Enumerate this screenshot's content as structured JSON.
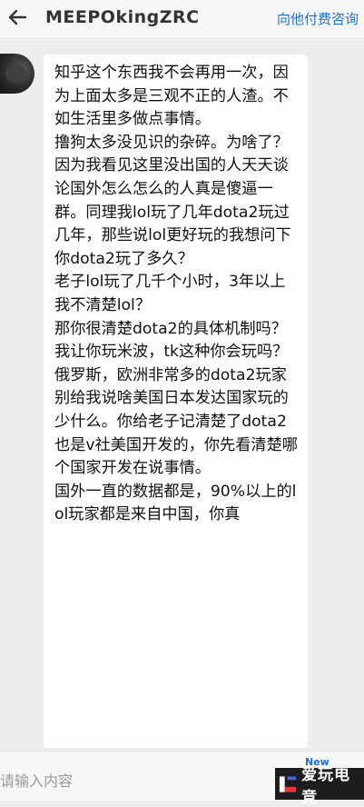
{
  "header": {
    "title": "MEEPOkingZRC",
    "consult_label": "向他付费咨询"
  },
  "message": {
    "paragraphs": [
      "知乎这个东西我不会再用一次，因为上面太多是三观不正的人渣。不如生活里多做点事情。",
      "撸狗太多没见识的杂碎。为啥了？因为我看见这里没出国的人天天谈论国外怎么怎么的人真是傻逼一群。同理我lol玩了几年dota2玩过几年，那些说lol更好玩的我想问下你dota2玩了多久？",
      "老子lol玩了几千个小时，3年以上我不清楚lol？",
      "那你很清楚dota2的具体机制吗？我让你玩米波，tk这种你会玩吗？",
      "俄罗斯，欧洲非常多的dota2玩家",
      "别给我说啥美国日本发达国家玩的少什么。你给老子记清楚了dota2也是v社美国开发的，你先看清楚哪个国家开发在说事情。",
      "国外一直的数据都是，90%以上的lol玩家都是来自中国，你真"
    ]
  },
  "composer": {
    "placeholder": "请输入内容",
    "new_badge": "New"
  },
  "watermark": {
    "text": "爱玩电竞"
  },
  "colors": {
    "accent": "#1f6fd8",
    "background": "#ededed",
    "bubble": "#ffffff"
  }
}
